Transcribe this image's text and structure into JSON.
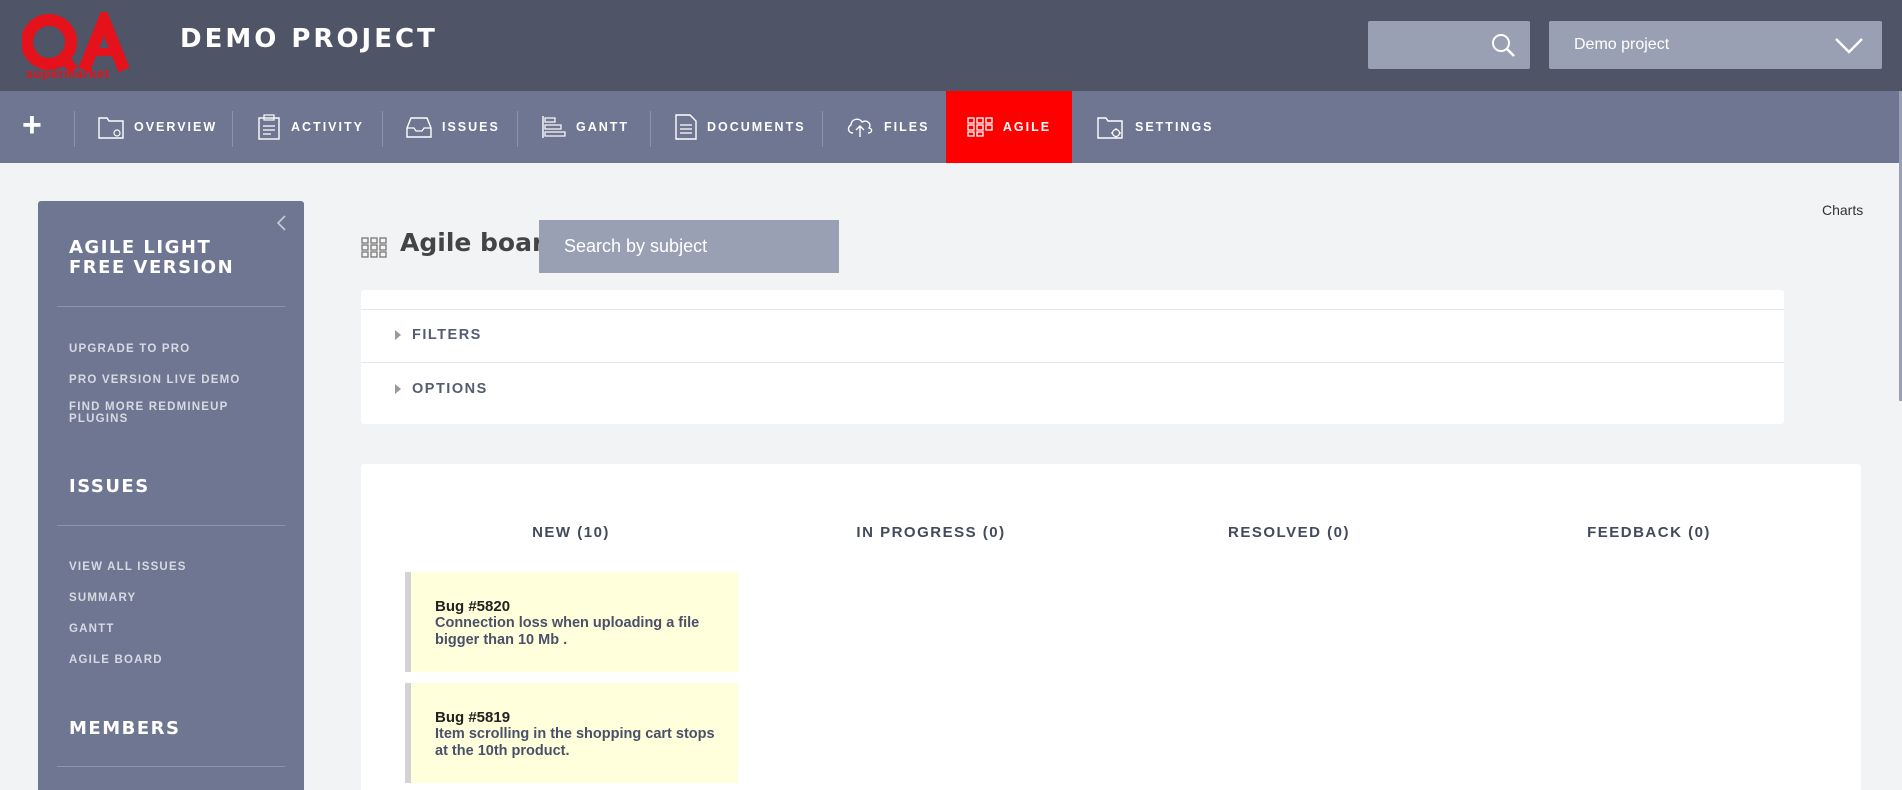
{
  "brand": {
    "logo_text": "QA",
    "logo_sub": "supermarket",
    "color": "#ff0000"
  },
  "header": {
    "project_title": "DEMO PROJECT",
    "search_placeholder": "",
    "project_select": "Demo project"
  },
  "nav": {
    "plus": "+",
    "items": [
      {
        "label": "OVERVIEW",
        "icon": "folder-icon"
      },
      {
        "label": "ACTIVITY",
        "icon": "clipboard-icon"
      },
      {
        "label": "ISSUES",
        "icon": "inbox-icon"
      },
      {
        "label": "GANTT",
        "icon": "gantt-icon"
      },
      {
        "label": "DOCUMENTS",
        "icon": "document-icon"
      },
      {
        "label": "FILES",
        "icon": "cloud-upload-icon"
      },
      {
        "label": "AGILE",
        "icon": "grid-icon",
        "active": true
      },
      {
        "label": "SETTINGS",
        "icon": "folder-gear-icon"
      }
    ]
  },
  "sidebar": {
    "agile_heading": "AGILE LIGHT FREE VERSION",
    "agile_links": [
      "UPGRADE TO PRO",
      "PRO VERSION LIVE DEMO",
      "FIND MORE REDMINEUP PLUGINS"
    ],
    "issues_heading": "ISSUES",
    "issues_links": [
      "VIEW ALL ISSUES",
      "SUMMARY",
      "GANTT",
      "AGILE BOARD"
    ],
    "members_heading": "MEMBERS"
  },
  "content": {
    "charts_link": "Charts",
    "board_title": "Agile board",
    "search_placeholder": "Search by subject",
    "filters_label": "FILTERS",
    "options_label": "OPTIONS"
  },
  "board": {
    "columns": [
      "NEW (10)",
      "IN PROGRESS (0)",
      "RESOLVED (0)",
      "FEEDBACK (0)"
    ],
    "cards": [
      {
        "id": "Bug #5820",
        "subject": "Connection loss when uploading a file bigger than 10 Mb ."
      },
      {
        "id": "Bug #5819",
        "subject": "Item scrolling in the shopping cart stops at the 10th product."
      }
    ]
  }
}
